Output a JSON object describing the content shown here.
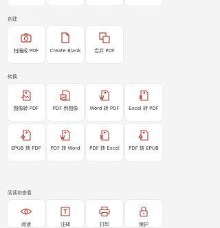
{
  "sections": {
    "create": "创建",
    "convert": "转换",
    "read": "阅读和查看"
  },
  "create_items": [
    {
      "label": "扫描成 PDF",
      "icon": "camera-icon"
    },
    {
      "label": "Create Blank",
      "icon": "blank-page-icon"
    },
    {
      "label": "合并 PDF",
      "icon": "merge-icon"
    }
  ],
  "convert_items": [
    {
      "label": "图像转 PDF",
      "icon": "image-to-pdf-icon"
    },
    {
      "label": "PDF 到图像",
      "icon": "pdf-to-image-icon"
    },
    {
      "label": "Word 转 PDF",
      "icon": "word-to-pdf-icon"
    },
    {
      "label": "Excel 转 PDF",
      "icon": "excel-to-pdf-icon"
    },
    {
      "label": "EPUB 转 PDF",
      "icon": "epub-to-pdf-icon"
    },
    {
      "label": "PDF 转 Word",
      "icon": "pdf-to-word-icon"
    },
    {
      "label": "PDF 转 Excel",
      "icon": "pdf-to-excel-icon"
    },
    {
      "label": "PDF 转 EPUB",
      "icon": "pdf-to-epub-icon"
    }
  ],
  "read_items": [
    {
      "label": "阅读",
      "icon": "eye-icon"
    },
    {
      "label": "注释",
      "icon": "annotate-icon"
    },
    {
      "label": "打印",
      "icon": "printer-icon"
    },
    {
      "label": "保护",
      "icon": "lock-icon"
    }
  ],
  "colors": {
    "accent": "#c0392b",
    "background": "#f4f4f4",
    "card": "#ffffff"
  }
}
